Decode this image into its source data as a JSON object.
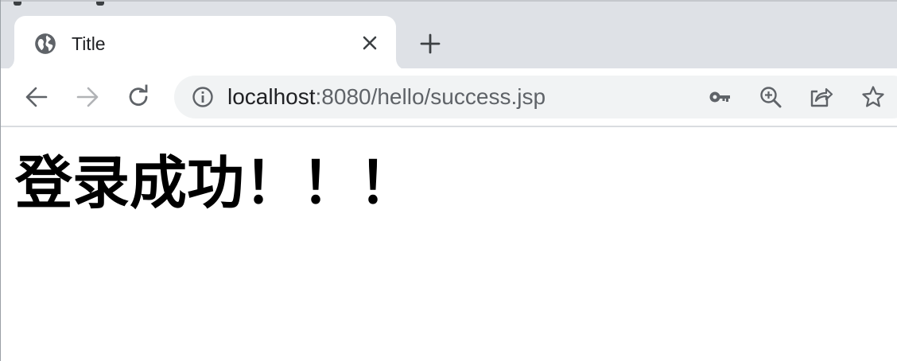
{
  "browser": {
    "tab": {
      "title": "Title",
      "favicon": "globe-icon",
      "close_icon": "close-icon"
    },
    "new_tab_icon": "plus-icon",
    "toolbar": {
      "back_icon": "arrow-left-icon",
      "forward_icon": "arrow-right-icon",
      "reload_icon": "reload-icon",
      "site_info_icon": "info-icon",
      "url_host": "localhost",
      "url_rest": ":8080/hello/success.jsp",
      "password_icon": "key-icon",
      "zoom_icon": "zoom-in-icon",
      "share_icon": "share-icon",
      "bookmark_icon": "star-icon"
    },
    "colors": {
      "tab_strip": "#dee1e6",
      "omnibox": "#f1f3f4",
      "icon": "#5f6368",
      "icon_disabled": "#b1b3b6"
    }
  },
  "page": {
    "heading": "登录成功！！！"
  }
}
